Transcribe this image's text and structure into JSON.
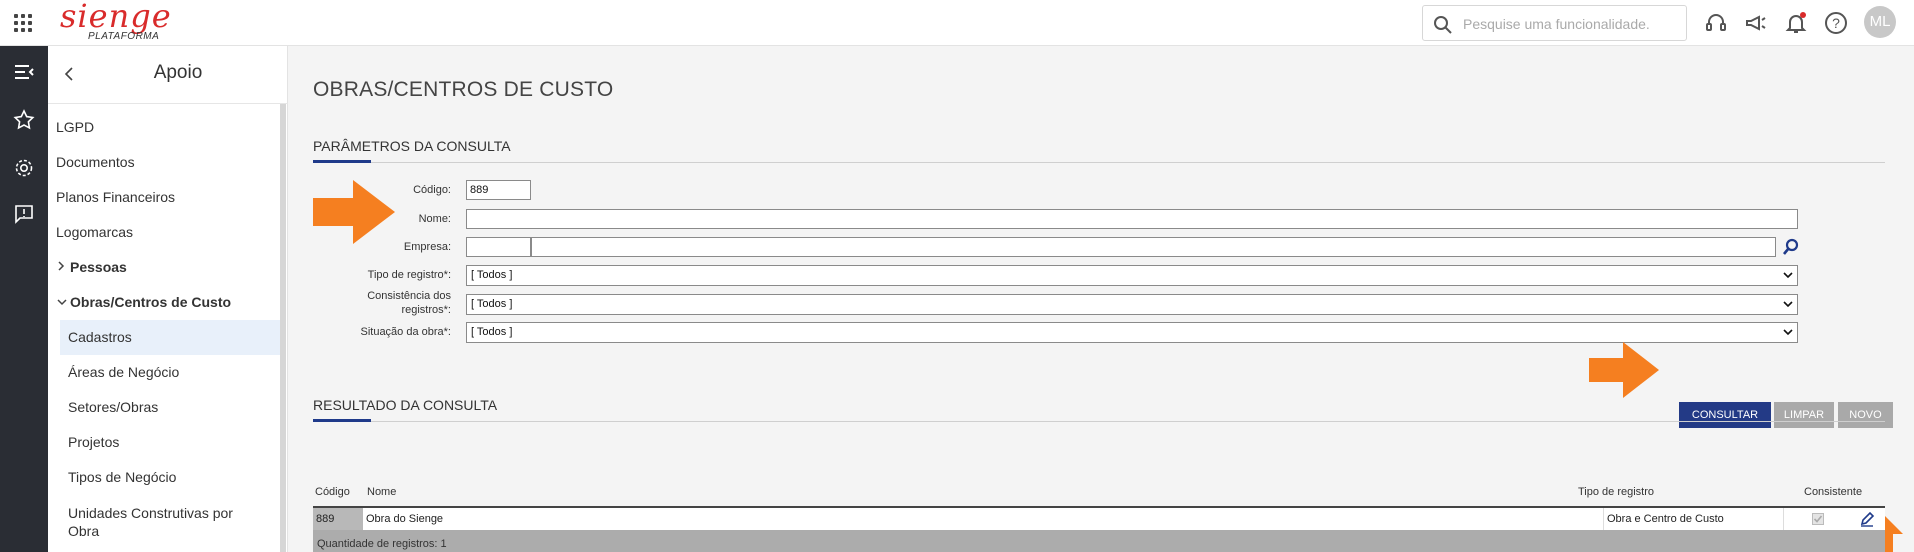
{
  "topbar": {
    "logo_text": "sienge",
    "logo_sub": "PLATAFORMA",
    "search_placeholder": "Pesquise uma funcionalidade.",
    "avatar_initials": "ML"
  },
  "sidebar": {
    "title": "Apoio",
    "items": [
      {
        "label": "LGPD"
      },
      {
        "label": "Documentos"
      },
      {
        "label": "Planos Financeiros"
      },
      {
        "label": "Logomarcas"
      },
      {
        "label": "Pessoas"
      },
      {
        "label": "Obras/Centros de Custo"
      },
      {
        "label": "Cadastros"
      },
      {
        "label": "Áreas de Negócio"
      },
      {
        "label": "Setores/Obras"
      },
      {
        "label": "Projetos"
      },
      {
        "label": "Tipos de Negócio"
      },
      {
        "label": "Unidades Construtivas por"
      },
      {
        "label": "Obra"
      }
    ]
  },
  "main": {
    "title": "OBRAS/CENTROS DE CUSTO",
    "params_title": "PARÂMETROS DA CONSULTA",
    "fields": {
      "codigo_label": "Código:",
      "codigo_value": "889",
      "nome_label": "Nome:",
      "nome_value": "",
      "empresa_label": "Empresa:",
      "empresa_code": "",
      "empresa_name": "",
      "tipo_label": "Tipo de registro*:",
      "tipo_value": "[ Todos ]",
      "consist_label_1": "Consistência dos",
      "consist_label_2": "registros*:",
      "consist_value": "[ Todos ]",
      "situacao_label": "Situação da obra*:",
      "situacao_value": "[ Todos ]"
    },
    "buttons": {
      "consultar": "CONSULTAR",
      "limpar": "LIMPAR",
      "novo": "NOVO"
    },
    "results_title": "RESULTADO DA CONSULTA",
    "table": {
      "headers": {
        "codigo": "Código",
        "nome": "Nome",
        "tipo": "Tipo de registro",
        "consistente": "Consistente"
      },
      "rows": [
        {
          "codigo": "889",
          "nome": "Obra do Sienge",
          "tipo": "Obra e Centro de Custo",
          "consistente": true
        }
      ],
      "footer": "Quantidade de registros: 1"
    }
  },
  "colors": {
    "accent": "#233a86",
    "brand": "#d92b2b",
    "arrow": "#f57f20",
    "rail": "#2a2d34"
  }
}
